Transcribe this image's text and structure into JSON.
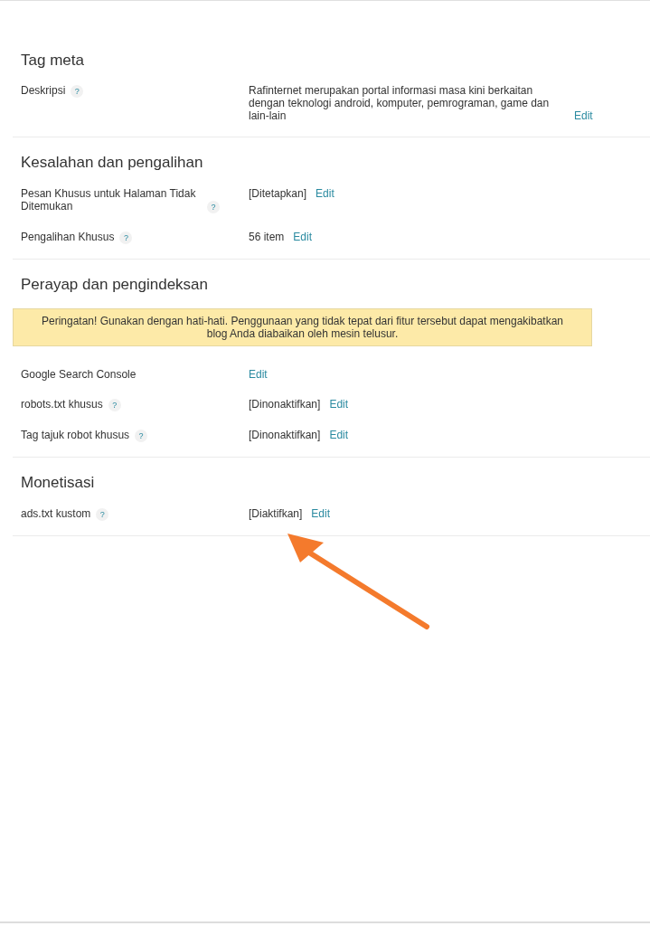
{
  "sections": [
    {
      "title": "Tag meta",
      "rows": [
        {
          "label": "Deskripsi",
          "help": true,
          "value": "Rafinternet merupakan portal informasi masa kini berkaitan dengan teknologi android, komputer, pemrograman, game dan lain-lain",
          "link": "Edit"
        }
      ]
    },
    {
      "title": "Kesalahan dan pengalihan",
      "rows": [
        {
          "label": "Pesan Khusus untuk Halaman Tidak Ditemukan",
          "help": true,
          "value": "[Ditetapkan]",
          "link": "Edit"
        },
        {
          "label": "Pengalihan Khusus",
          "help": true,
          "value": "56 item",
          "link": "Edit"
        }
      ]
    },
    {
      "title": "Perayap dan pengindeksan",
      "warning": "Peringatan! Gunakan dengan hati-hati. Penggunaan yang tidak tepat dari fitur tersebut dapat mengakibatkan blog Anda diabaikan oleh mesin telusur.",
      "rows": [
        {
          "label": "Google Search Console",
          "help": false,
          "link": "Edit"
        },
        {
          "label": "robots.txt khusus",
          "help": true,
          "value": "[Dinonaktifkan]",
          "link": "Edit"
        },
        {
          "label": "Tag tajuk robot khusus",
          "help": true,
          "value": "[Dinonaktifkan]",
          "link": "Edit"
        }
      ]
    },
    {
      "title": "Monetisasi",
      "rows": [
        {
          "label": "ads.txt kustom",
          "help": true,
          "value": "[Diaktifkan]",
          "link": "Edit"
        }
      ]
    }
  ],
  "help_mark": "?"
}
